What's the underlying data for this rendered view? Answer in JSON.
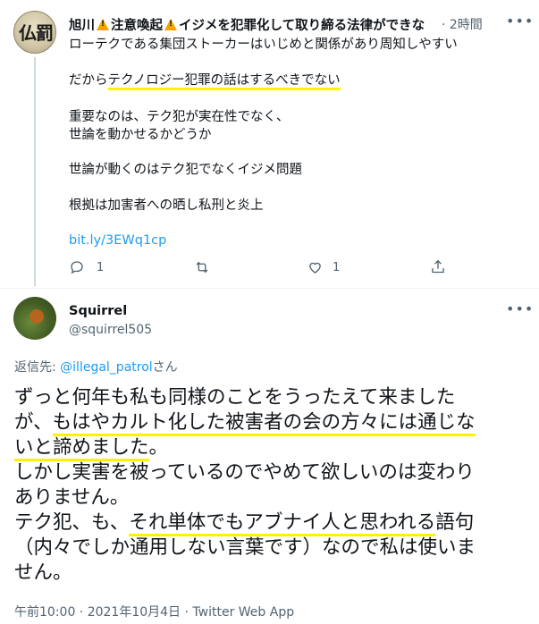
{
  "parent_tweet": {
    "author_name": "旭川",
    "name_rest_1": "注意喚起",
    "name_rest_2": "イジメを犯罪化して取り締る法律ができな",
    "avatar_text": "仏罰",
    "time": "· 2時間",
    "line1": "ローテクである集団ストーカーはいじめと関係があり周知しやすい",
    "line2_pre": "だから",
    "line2_hl": "テクノロジー犯罪の話はするべきでない",
    "line3a": "重要なのは、テク犯が実在性でなく、",
    "line3b": "世論を動かせるかどうか",
    "line4": "世論が動くのはテク犯でなくイジメ問題",
    "line5": "根拠は加害者への晒し私刑と炎上",
    "link": "bit.ly/3EWq1cp",
    "reply_count": "1",
    "like_count": "1"
  },
  "main_tweet": {
    "author_name": "Squirrel",
    "handle": "@squirrel505",
    "reply_label": "返信先: ",
    "reply_mention": "@illegal_patrol",
    "reply_suffix": "さん",
    "l1": "ずっと何年も私も同様のことをうったえて来ました",
    "l2_pre": "が、",
    "l2_hl": "もはやカルト化した被害者の会の方々には通じな",
    "l3_hl": "いと諦めました",
    "l3_post": "。",
    "l4": "しかし実害を被っているのでやめて欲しいのは変わり",
    "l5": "ありません。",
    "l6_pre": "テク犯、も、",
    "l6_hl": "それ単体でもアブナイ人と思われる",
    "l6_post": "語句",
    "l7": "（内々でしか通用しない言葉です）なので私は使いま",
    "l8": "せん。",
    "footer": "午前10:00 · 2021年10月4日 · Twitter Web App"
  },
  "colors": {
    "accent": "#1d9bf0",
    "highlight": "#fff200",
    "secondary_text": "#536471"
  }
}
